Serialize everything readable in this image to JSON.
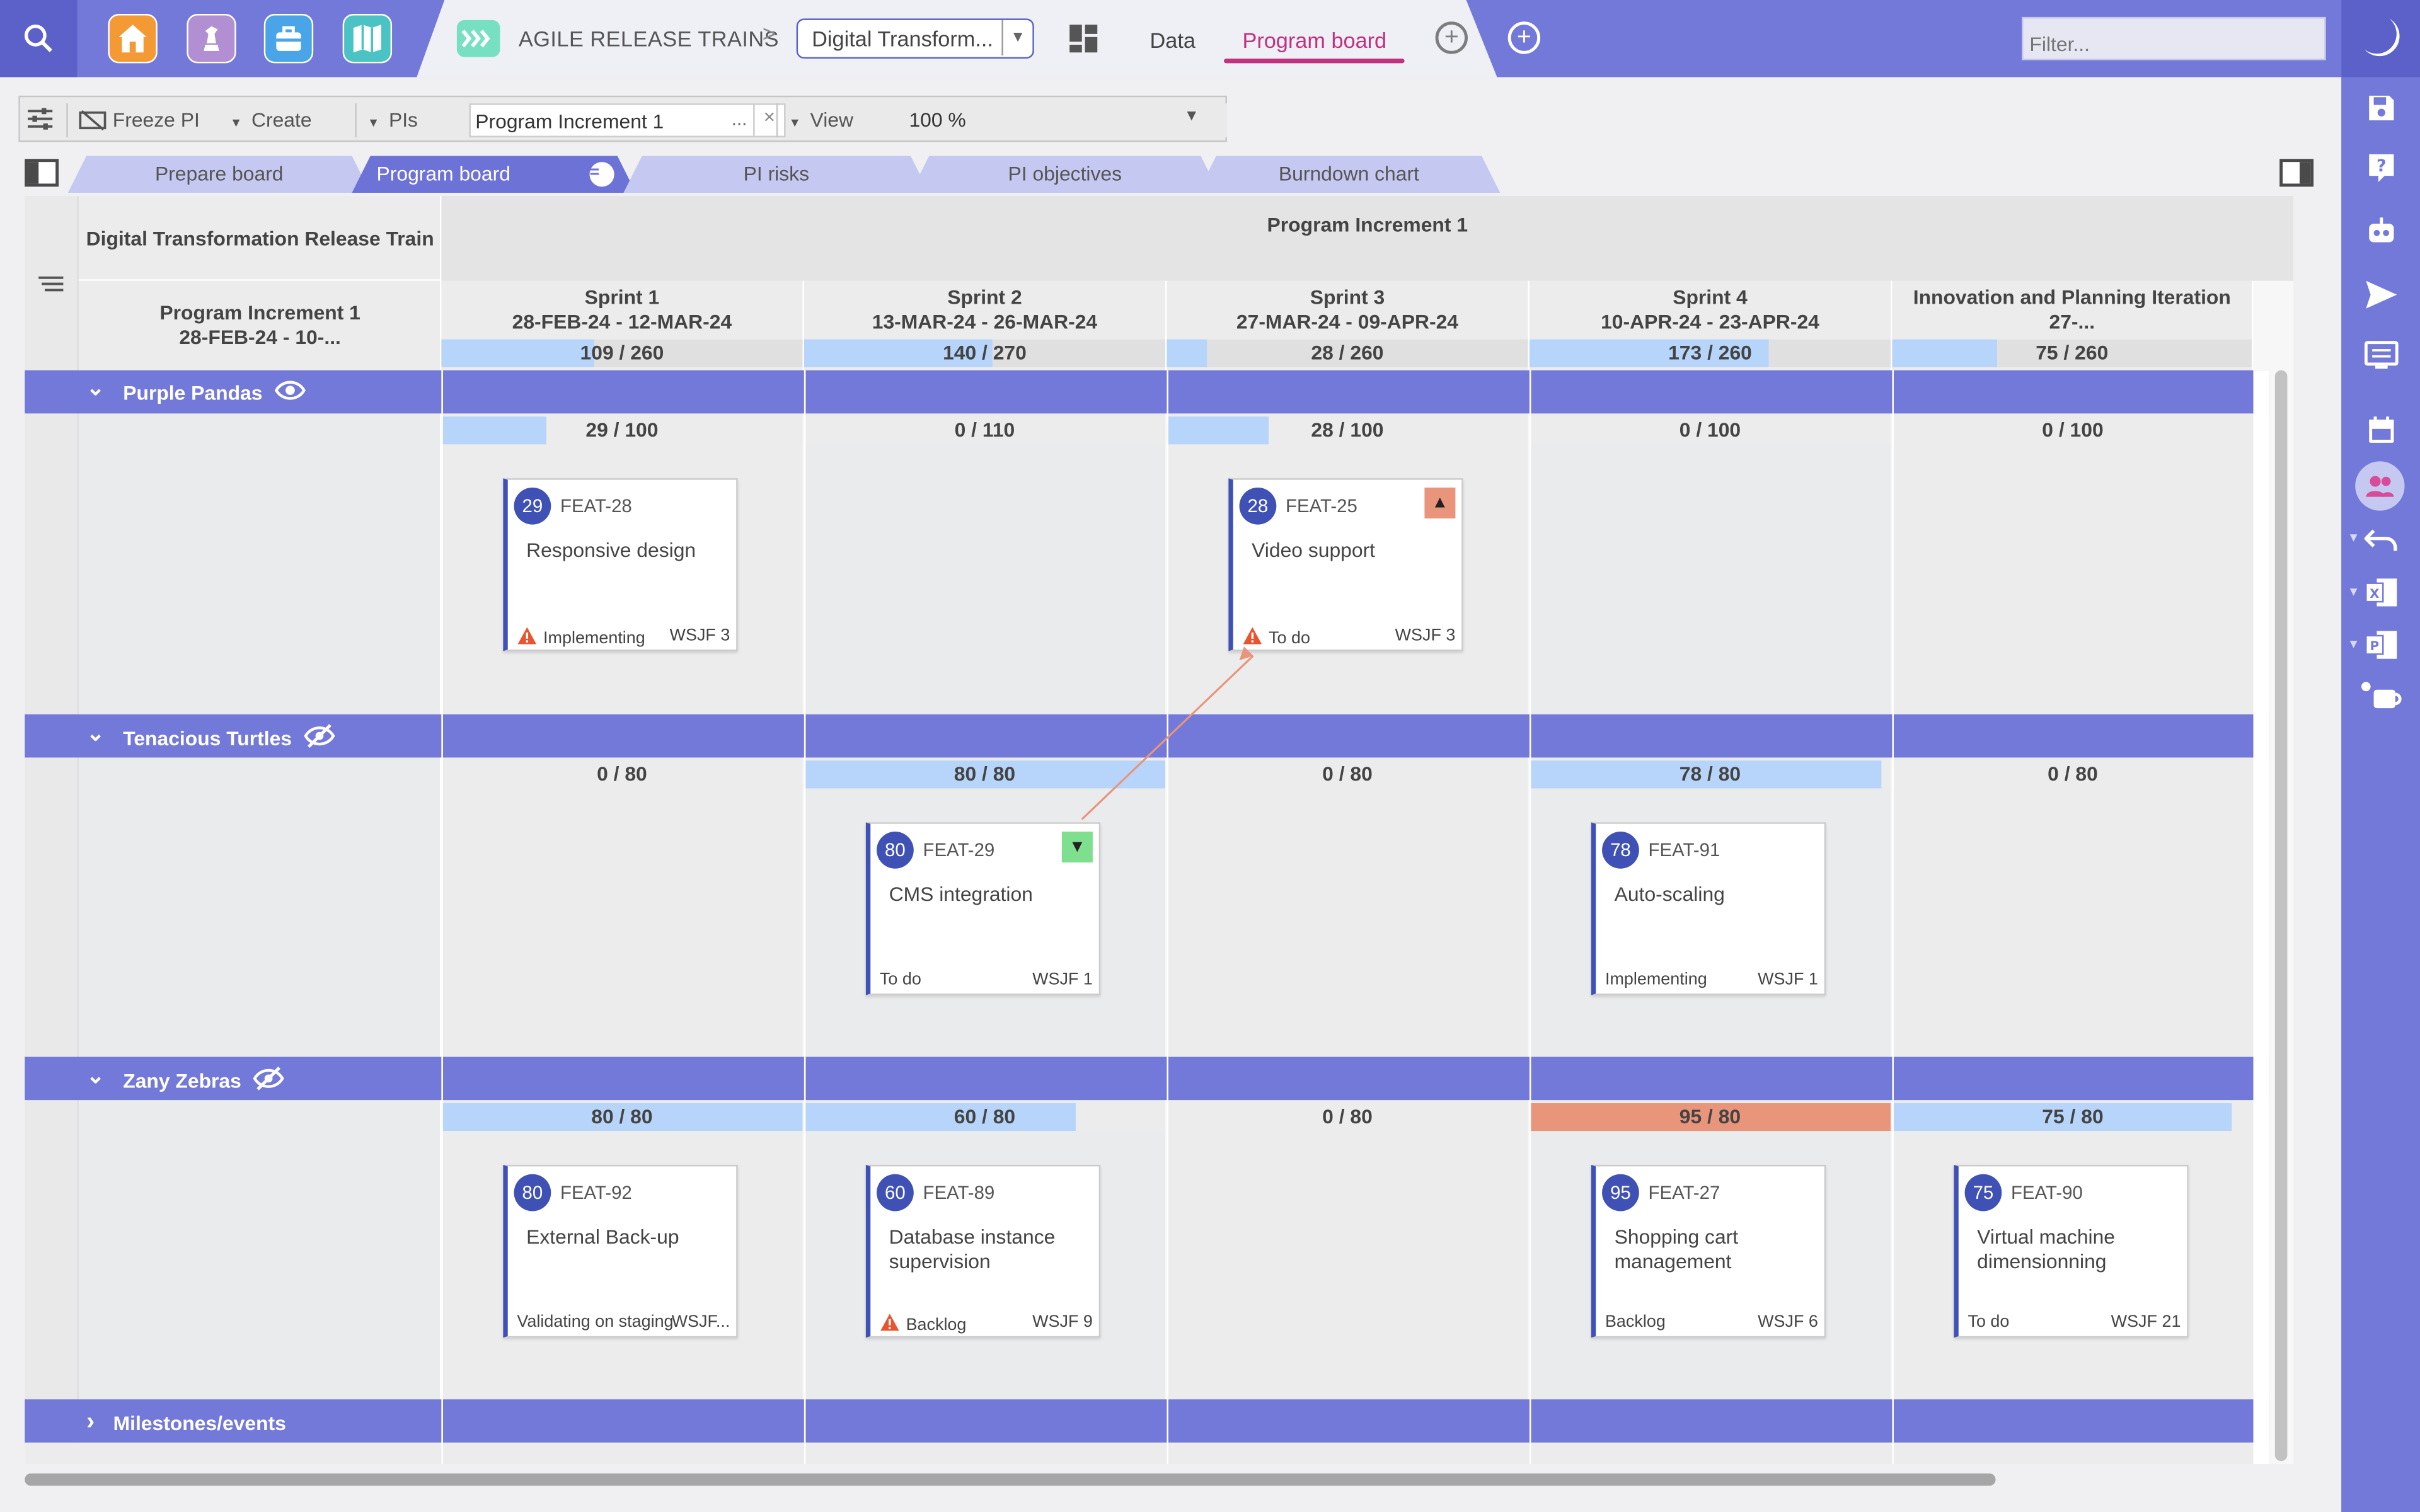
{
  "topbar": {
    "breadcrumb_title": "AGILE RELEASE TRAINS",
    "breadcrumb_sep": ">",
    "train_select": "Digital Transform...",
    "tabs": [
      "Data",
      "Program board"
    ],
    "active_tab": "Program board",
    "filter_placeholder": "Filter..."
  },
  "toolbar": {
    "freeze": "Freeze PI",
    "create": "Create",
    "pis": "PIs",
    "pi_value": "Program Increment 1",
    "pi_dots": "...",
    "clear": "×",
    "view": "View",
    "zoom": "100 %"
  },
  "board_tabs": [
    "Prepare board",
    "Program board",
    "PI risks",
    "PI objectives",
    "Burndown chart"
  ],
  "board": {
    "train_name": "Digital Transformation Release Train",
    "pi_left": "Program Increment 1",
    "pi_left_dates": "28-FEB-24 - 10-...",
    "pi_title": "Program Increment 1",
    "sprints": [
      {
        "name": "Sprint 1",
        "dates": "28-FEB-24 - 12-MAR-24",
        "cap": "109 / 260",
        "load": 0.42
      },
      {
        "name": "Sprint 2",
        "dates": "13-MAR-24 - 26-MAR-24",
        "cap": "140 / 270",
        "load": 0.52
      },
      {
        "name": "Sprint 3",
        "dates": "27-MAR-24 - 09-APR-24",
        "cap": "28 / 260",
        "load": 0.11
      },
      {
        "name": "Sprint 4",
        "dates": "10-APR-24 - 23-APR-24",
        "cap": "173 / 260",
        "load": 0.66
      },
      {
        "name": "Innovation and Planning Iteration",
        "dates": "27-...",
        "cap": "75 / 260",
        "load": 0.29
      }
    ],
    "teams": [
      {
        "name": "Purple Pandas",
        "visibility_icon": "eye-icon",
        "caps": [
          {
            "text": "29 / 100",
            "load": 0.29
          },
          {
            "text": "0 / 110",
            "load": 0
          },
          {
            "text": "28 / 100",
            "load": 0.28
          },
          {
            "text": "0 / 100",
            "load": 0
          },
          {
            "text": "0 / 100",
            "load": 0
          }
        ],
        "cards": [
          {
            "col": 0,
            "points": "29",
            "key": "FEAT-28",
            "title": "Responsive design",
            "status": "Implementing",
            "wsjf": "WSJF 3",
            "warn": true,
            "priority": ""
          },
          {
            "col": 2,
            "points": "28",
            "key": "FEAT-25",
            "title": "Video support",
            "status": "To do",
            "wsjf": "WSJF 3",
            "warn": true,
            "priority": "up"
          }
        ]
      },
      {
        "name": "Tenacious Turtles",
        "visibility_icon": "eye-off-icon",
        "caps": [
          {
            "text": "0 / 80",
            "load": 0
          },
          {
            "text": "80 / 80",
            "load": 1
          },
          {
            "text": "0 / 80",
            "load": 0
          },
          {
            "text": "78 / 80",
            "load": 0.975
          },
          {
            "text": "0 / 80",
            "load": 0
          }
        ],
        "cards": [
          {
            "col": 1,
            "points": "80",
            "key": "FEAT-29",
            "title": "CMS integration",
            "status": "To do",
            "wsjf": "WSJF 1",
            "warn": false,
            "priority": "down"
          },
          {
            "col": 3,
            "points": "78",
            "key": "FEAT-91",
            "title": "Auto-scaling",
            "status": "Implementing",
            "wsjf": "WSJF 1",
            "warn": false,
            "priority": ""
          }
        ]
      },
      {
        "name": "Zany Zebras",
        "visibility_icon": "eye-off-icon",
        "caps": [
          {
            "text": "80 / 80",
            "load": 1
          },
          {
            "text": "60 / 80",
            "load": 0.75
          },
          {
            "text": "0 / 80",
            "load": 0
          },
          {
            "text": "95 / 80",
            "load": 1.19
          },
          {
            "text": "75 / 80",
            "load": 0.94
          }
        ],
        "cards": [
          {
            "col": 0,
            "points": "80",
            "key": "FEAT-92",
            "title": "External Back-up",
            "status": "Validating on staging",
            "wsjf": "WSJF...",
            "warn": false,
            "priority": ""
          },
          {
            "col": 1,
            "points": "60",
            "key": "FEAT-89",
            "title": "Database instance supervision",
            "status": "Backlog",
            "wsjf": "WSJF 9",
            "warn": true,
            "priority": ""
          },
          {
            "col": 3,
            "points": "95",
            "key": "FEAT-27",
            "title": "Shopping cart management",
            "status": "Backlog",
            "wsjf": "WSJF 6",
            "warn": false,
            "priority": ""
          },
          {
            "col": 4,
            "points": "75",
            "key": "FEAT-90",
            "title": "Virtual machine dimensionning",
            "status": "To do",
            "wsjf": "WSJF 21",
            "warn": false,
            "priority": ""
          }
        ]
      }
    ],
    "milestones": "Milestones/events"
  },
  "colors": {
    "brand": "#7379d8",
    "brand_dark": "#5b61c9",
    "active_tab": "#c0327f",
    "card_accent": "#3f51b5",
    "capacity_fill": "#b7d5fa",
    "capacity_over": "#e8957b",
    "warning": "#e8542f",
    "priority_up": "#e8957b",
    "priority_down": "#7ee08f"
  }
}
